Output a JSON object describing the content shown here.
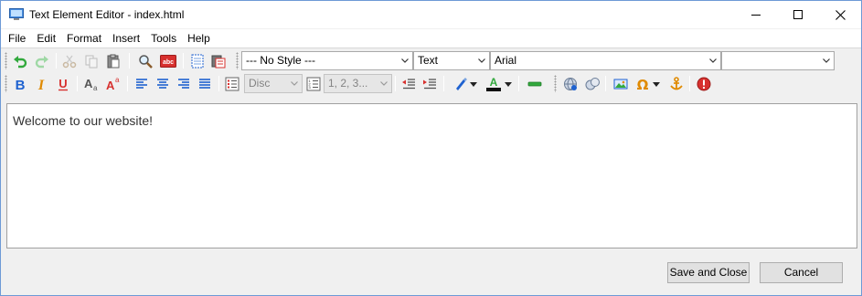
{
  "window": {
    "title": "Text Element Editor - index.html"
  },
  "menu": [
    "File",
    "Edit",
    "Format",
    "Insert",
    "Tools",
    "Help"
  ],
  "toolbar": {
    "style_select": "--- No Style ---",
    "block_select": "Text",
    "font_select": "Arial",
    "size_select": "",
    "bullet_select": "Disc",
    "numbering_select": "1, 2, 3..."
  },
  "editor": {
    "content": "Welcome to our website!"
  },
  "buttons": {
    "save_close": "Save and Close",
    "cancel": "Cancel"
  },
  "colors": {
    "accent": "#6e9ad6",
    "red_icon": "#d7302e",
    "blue_icon": "#1f62d0",
    "orange_icon": "#e08a00",
    "green_icon": "#32a93d"
  }
}
